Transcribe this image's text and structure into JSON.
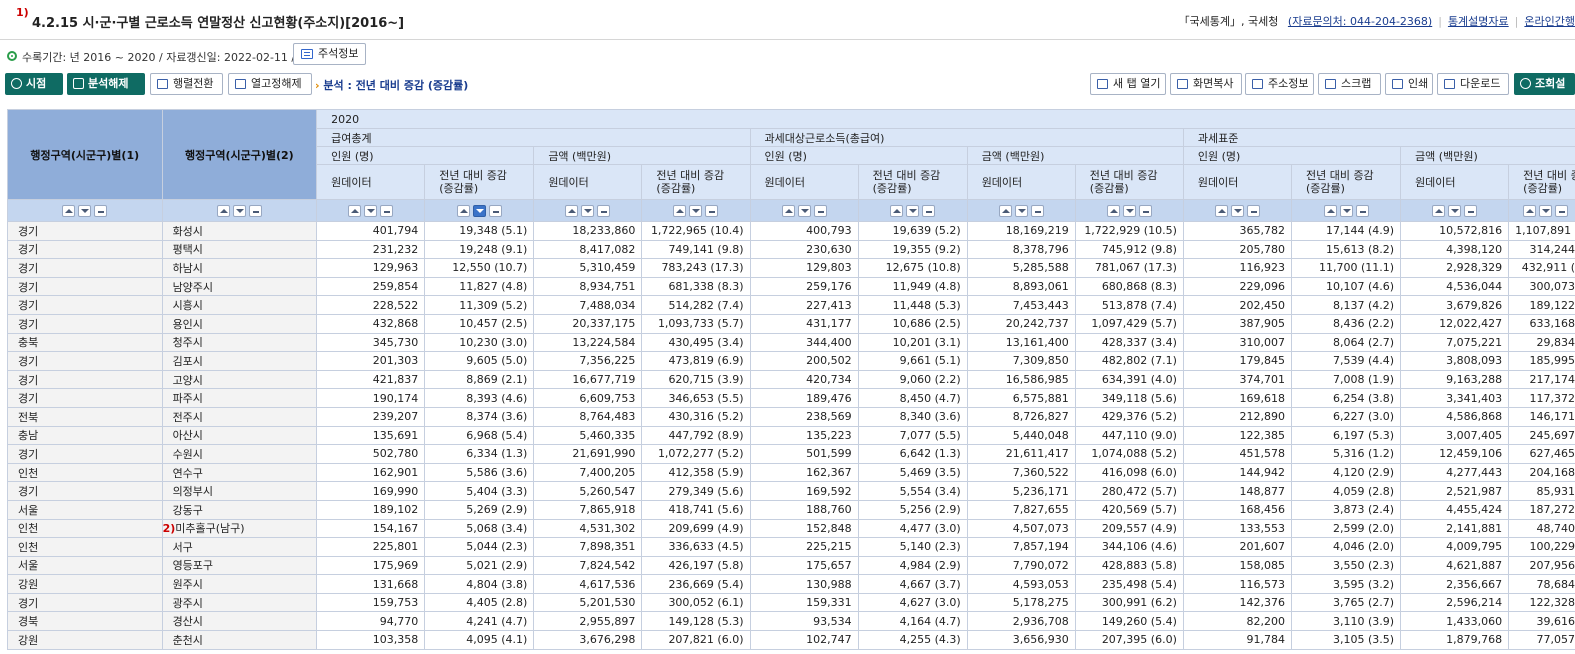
{
  "title": {
    "note": "1)",
    "text": "4.2.15 시·군·구별 근로소득 연말정산 신고현황(주소지)[2016~]",
    "source": "「국세통계」, 국세청",
    "contact": "(자료문의처: 044-204-2368)",
    "link_desc": "통계설명자료",
    "link_online": "온라인간행"
  },
  "info": {
    "period": "수록기간: 년 2016 ~ 2020 / 자료갱신일: 2022-02-11 /",
    "footnote_btn": "주석정보"
  },
  "toolbar": {
    "left": [
      "시점",
      "분석해제"
    ],
    "mid": [
      "행렬전환",
      "열고정해제"
    ],
    "analysis": "분석 : 전년 대비 증감 (증감률)",
    "right": [
      "새 탭 열기",
      "화면복사",
      "주소정보",
      "스크랩",
      "인쇄",
      "다운로드",
      "조회설"
    ]
  },
  "table": {
    "dim1": "행정구역(시군구)별(1)",
    "dim2": "행정구역(시군구)별(2)",
    "year": "2020",
    "groups": [
      "급여총계",
      "과세대상근로소득(총급여)",
      "과세표준"
    ],
    "sub": [
      "인원 (명)",
      "금액 (백만원)"
    ],
    "leaf": [
      "원데이터",
      "전년 대비 증감\n(증감률)"
    ],
    "footnote2": "2)",
    "rows": [
      [
        "경기",
        "화성시",
        "401,794",
        "19,348 (5.1)",
        "18,233,860",
        "1,722,965 (10.4)",
        "400,793",
        "19,639 (5.2)",
        "18,169,219",
        "1,722,929 (10.5)",
        "365,782",
        "17,144 (4.9)",
        "10,572,816",
        "1,107,891 (1"
      ],
      [
        "경기",
        "평택시",
        "231,232",
        "19,248 (9.1)",
        "8,417,082",
        "749,141 (9.8)",
        "230,630",
        "19,355 (9.2)",
        "8,378,796",
        "745,912 (9.8)",
        "205,780",
        "15,613 (8.2)",
        "4,398,120",
        "314,244"
      ],
      [
        "경기",
        "하남시",
        "129,963",
        "12,550 (10.7)",
        "5,310,459",
        "783,243 (17.3)",
        "129,803",
        "12,675 (10.8)",
        "5,285,588",
        "781,067 (17.3)",
        "116,923",
        "11,700 (11.1)",
        "2,928,329",
        "432,911 ("
      ],
      [
        "경기",
        "남양주시",
        "259,854",
        "11,827 (4.8)",
        "8,934,751",
        "681,338 (8.3)",
        "259,176",
        "11,949 (4.8)",
        "8,893,061",
        "680,868 (8.3)",
        "229,096",
        "10,107 (4.6)",
        "4,536,044",
        "300,073"
      ],
      [
        "경기",
        "시흥시",
        "228,522",
        "11,309 (5.2)",
        "7,488,034",
        "514,282 (7.4)",
        "227,413",
        "11,448 (5.3)",
        "7,453,443",
        "513,878 (7.4)",
        "202,450",
        "8,137 (4.2)",
        "3,679,826",
        "189,122"
      ],
      [
        "경기",
        "용인시",
        "432,868",
        "10,457 (2.5)",
        "20,337,175",
        "1,093,733 (5.7)",
        "431,177",
        "10,686 (2.5)",
        "20,242,737",
        "1,097,429 (5.7)",
        "387,905",
        "8,436 (2.2)",
        "12,022,427",
        "633,168"
      ],
      [
        "충북",
        "청주시",
        "345,730",
        "10,230 (3.0)",
        "13,224,584",
        "430,495 (3.4)",
        "344,400",
        "10,201 (3.1)",
        "13,161,400",
        "428,337 (3.4)",
        "310,007",
        "8,064 (2.7)",
        "7,075,221",
        "29,834"
      ],
      [
        "경기",
        "김포시",
        "201,303",
        "9,605 (5.0)",
        "7,356,225",
        "473,819 (6.9)",
        "200,502",
        "9,661 (5.1)",
        "7,309,850",
        "482,802 (7.1)",
        "179,845",
        "7,539 (4.4)",
        "3,808,093",
        "185,995"
      ],
      [
        "경기",
        "고양시",
        "421,837",
        "8,869 (2.1)",
        "16,677,719",
        "620,715 (3.9)",
        "420,734",
        "9,060 (2.2)",
        "16,586,985",
        "634,391 (4.0)",
        "374,701",
        "7,008 (1.9)",
        "9,163,288",
        "217,174"
      ],
      [
        "경기",
        "파주시",
        "190,174",
        "8,393 (4.6)",
        "6,609,753",
        "346,653 (5.5)",
        "189,476",
        "8,450 (4.7)",
        "6,575,881",
        "349,118 (5.6)",
        "169,618",
        "6,254 (3.8)",
        "3,341,403",
        "117,372"
      ],
      [
        "전북",
        "전주시",
        "239,207",
        "8,374 (3.6)",
        "8,764,483",
        "430,316 (5.2)",
        "238,569",
        "8,340 (3.6)",
        "8,726,827",
        "429,376 (5.2)",
        "212,890",
        "6,227 (3.0)",
        "4,586,868",
        "146,171"
      ],
      [
        "충남",
        "아산시",
        "135,691",
        "6,968 (5.4)",
        "5,460,335",
        "447,792 (8.9)",
        "135,223",
        "7,077 (5.5)",
        "5,440,048",
        "447,110 (9.0)",
        "122,385",
        "6,197 (5.3)",
        "3,007,405",
        "245,697"
      ],
      [
        "경기",
        "수원시",
        "502,780",
        "6,334 (1.3)",
        "21,691,990",
        "1,072,277 (5.2)",
        "501,599",
        "6,642 (1.3)",
        "21,611,417",
        "1,074,088 (5.2)",
        "451,578",
        "5,316 (1.2)",
        "12,459,106",
        "627,465"
      ],
      [
        "인천",
        "연수구",
        "162,901",
        "5,586 (3.6)",
        "7,400,205",
        "412,358 (5.9)",
        "162,367",
        "5,469 (3.5)",
        "7,360,522",
        "416,098 (6.0)",
        "144,942",
        "4,120 (2.9)",
        "4,277,443",
        "204,168"
      ],
      [
        "경기",
        "의정부시",
        "169,990",
        "5,404 (3.3)",
        "5,260,547",
        "279,349 (5.6)",
        "169,592",
        "5,554 (3.4)",
        "5,236,171",
        "280,472 (5.7)",
        "148,877",
        "4,059 (2.8)",
        "2,521,987",
        "85,931"
      ],
      [
        "서울",
        "강동구",
        "189,102",
        "5,269 (2.9)",
        "7,865,918",
        "418,741 (5.6)",
        "188,760",
        "5,256 (2.9)",
        "7,827,655",
        "420,569 (5.7)",
        "168,456",
        "3,873 (2.4)",
        "4,455,424",
        "187,272"
      ],
      [
        "인천",
        "미추홀구(남구)",
        "154,167",
        "5,068 (3.4)",
        "4,531,302",
        "209,699 (4.9)",
        "152,848",
        "4,477 (3.0)",
        "4,507,073",
        "209,557 (4.9)",
        "133,553",
        "2,599 (2.0)",
        "2,141,881",
        "48,740"
      ],
      [
        "인천",
        "서구",
        "225,801",
        "5,044 (2.3)",
        "7,898,351",
        "336,633 (4.5)",
        "225,215",
        "5,140 (2.3)",
        "7,857,194",
        "344,106 (4.6)",
        "201,607",
        "4,046 (2.0)",
        "4,009,795",
        "100,229"
      ],
      [
        "서울",
        "영등포구",
        "175,969",
        "5,021 (2.9)",
        "7,824,542",
        "426,197 (5.8)",
        "175,657",
        "4,984 (2.9)",
        "7,790,072",
        "428,883 (5.8)",
        "158,085",
        "3,550 (2.3)",
        "4,621,887",
        "207,956"
      ],
      [
        "강원",
        "원주시",
        "131,668",
        "4,804 (3.8)",
        "4,617,536",
        "236,669 (5.4)",
        "130,988",
        "4,667 (3.7)",
        "4,593,053",
        "235,498 (5.4)",
        "116,573",
        "3,595 (3.2)",
        "2,356,667",
        "78,684"
      ],
      [
        "경기",
        "광주시",
        "159,753",
        "4,405 (2.8)",
        "5,201,530",
        "300,052 (6.1)",
        "159,331",
        "4,627 (3.0)",
        "5,178,275",
        "300,991 (6.2)",
        "142,376",
        "3,765 (2.7)",
        "2,596,214",
        "122,328"
      ],
      [
        "경북",
        "경산시",
        "94,770",
        "4,241 (4.7)",
        "2,955,897",
        "149,128 (5.3)",
        "93,534",
        "4,164 (4.7)",
        "2,936,708",
        "149,260 (5.4)",
        "82,200",
        "3,110 (3.9)",
        "1,433,060",
        "39,616"
      ],
      [
        "강원",
        "춘천시",
        "103,358",
        "4,095 (4.1)",
        "3,676,298",
        "207,821 (6.0)",
        "102,747",
        "4,255 (4.3)",
        "3,656,930",
        "207,395 (6.0)",
        "91,784",
        "3,105 (3.5)",
        "1,879,768",
        "77,057"
      ]
    ]
  }
}
